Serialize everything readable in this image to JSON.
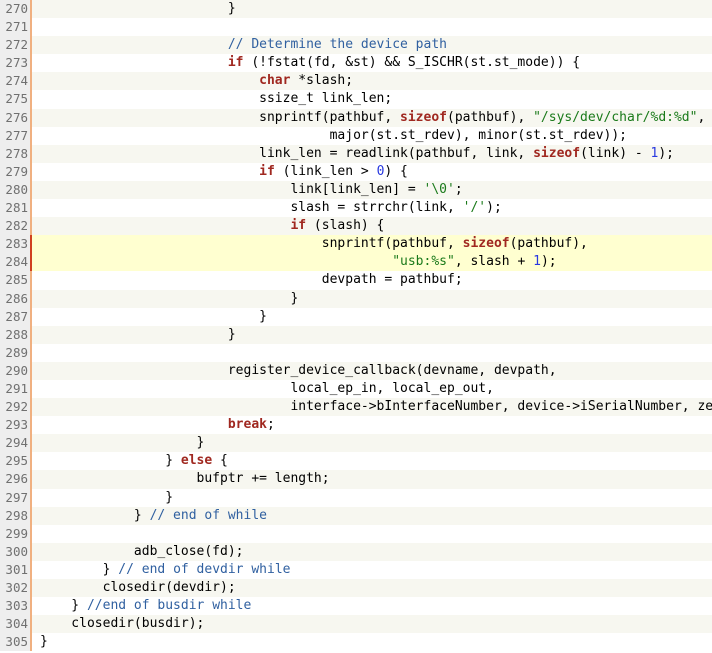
{
  "lines": [
    {
      "n": 270,
      "alt": true,
      "hl": false,
      "g": false,
      "segs": [
        {
          "t": "                        }",
          "c": ""
        }
      ]
    },
    {
      "n": 271,
      "alt": false,
      "hl": false,
      "g": false,
      "segs": [
        {
          "t": "",
          "c": ""
        }
      ]
    },
    {
      "n": 272,
      "alt": true,
      "hl": false,
      "g": false,
      "segs": [
        {
          "t": "                        ",
          "c": ""
        },
        {
          "t": "// Determine the device path",
          "c": "cm"
        }
      ]
    },
    {
      "n": 273,
      "alt": false,
      "hl": false,
      "g": false,
      "segs": [
        {
          "t": "                        ",
          "c": ""
        },
        {
          "t": "if",
          "c": "kw"
        },
        {
          "t": " (!fstat(fd, &st) && S_ISCHR(st.st_mode)) {",
          "c": ""
        }
      ]
    },
    {
      "n": 274,
      "alt": true,
      "hl": false,
      "g": false,
      "segs": [
        {
          "t": "                            ",
          "c": ""
        },
        {
          "t": "char",
          "c": "kw"
        },
        {
          "t": " *slash;",
          "c": ""
        }
      ]
    },
    {
      "n": 275,
      "alt": false,
      "hl": false,
      "g": false,
      "segs": [
        {
          "t": "                            ssize_t link_len;",
          "c": ""
        }
      ]
    },
    {
      "n": 276,
      "alt": true,
      "hl": false,
      "g": false,
      "segs": [
        {
          "t": "                            snprintf(pathbuf, ",
          "c": ""
        },
        {
          "t": "sizeof",
          "c": "kw"
        },
        {
          "t": "(pathbuf), ",
          "c": ""
        },
        {
          "t": "\"/sys/dev/char/%d:%d\"",
          "c": "st"
        },
        {
          "t": ",",
          "c": ""
        }
      ]
    },
    {
      "n": 277,
      "alt": false,
      "hl": false,
      "g": false,
      "segs": [
        {
          "t": "                                     major(st.st_rdev), minor(st.st_rdev));",
          "c": ""
        }
      ]
    },
    {
      "n": 278,
      "alt": true,
      "hl": false,
      "g": false,
      "segs": [
        {
          "t": "                            link_len = readlink(pathbuf, link, ",
          "c": ""
        },
        {
          "t": "sizeof",
          "c": "kw"
        },
        {
          "t": "(link) - ",
          "c": ""
        },
        {
          "t": "1",
          "c": "lit"
        },
        {
          "t": ");",
          "c": ""
        }
      ]
    },
    {
      "n": 279,
      "alt": false,
      "hl": false,
      "g": false,
      "segs": [
        {
          "t": "                            ",
          "c": ""
        },
        {
          "t": "if",
          "c": "kw"
        },
        {
          "t": " (link_len > ",
          "c": ""
        },
        {
          "t": "0",
          "c": "lit"
        },
        {
          "t": ") {",
          "c": ""
        }
      ]
    },
    {
      "n": 280,
      "alt": true,
      "hl": false,
      "g": false,
      "segs": [
        {
          "t": "                                link[link_len] = ",
          "c": ""
        },
        {
          "t": "'\\0'",
          "c": "st"
        },
        {
          "t": ";",
          "c": ""
        }
      ]
    },
    {
      "n": 281,
      "alt": false,
      "hl": false,
      "g": false,
      "segs": [
        {
          "t": "                                slash = strrchr(link, ",
          "c": ""
        },
        {
          "t": "'/'",
          "c": "st"
        },
        {
          "t": ");",
          "c": ""
        }
      ]
    },
    {
      "n": 282,
      "alt": true,
      "hl": false,
      "g": false,
      "segs": [
        {
          "t": "                                ",
          "c": ""
        },
        {
          "t": "if",
          "c": "kw"
        },
        {
          "t": " (slash) {",
          "c": ""
        }
      ]
    },
    {
      "n": 283,
      "alt": false,
      "hl": true,
      "g": true,
      "segs": [
        {
          "t": "                                    snprintf(pathbuf, ",
          "c": ""
        },
        {
          "t": "sizeof",
          "c": "kw"
        },
        {
          "t": "(pathbuf),",
          "c": ""
        }
      ]
    },
    {
      "n": 284,
      "alt": true,
      "hl": true,
      "g": true,
      "segs": [
        {
          "t": "                                             ",
          "c": ""
        },
        {
          "t": "\"usb:%s\"",
          "c": "st"
        },
        {
          "t": ", slash + ",
          "c": ""
        },
        {
          "t": "1",
          "c": "lit"
        },
        {
          "t": ");",
          "c": ""
        }
      ]
    },
    {
      "n": 285,
      "alt": false,
      "hl": false,
      "g": false,
      "segs": [
        {
          "t": "                                    devpath = pathbuf;",
          "c": ""
        }
      ]
    },
    {
      "n": 286,
      "alt": true,
      "hl": false,
      "g": false,
      "segs": [
        {
          "t": "                                }",
          "c": ""
        }
      ]
    },
    {
      "n": 287,
      "alt": false,
      "hl": false,
      "g": false,
      "segs": [
        {
          "t": "                            }",
          "c": ""
        }
      ]
    },
    {
      "n": 288,
      "alt": true,
      "hl": false,
      "g": false,
      "segs": [
        {
          "t": "                        }",
          "c": ""
        }
      ]
    },
    {
      "n": 289,
      "alt": false,
      "hl": false,
      "g": false,
      "segs": [
        {
          "t": "",
          "c": ""
        }
      ]
    },
    {
      "n": 290,
      "alt": true,
      "hl": false,
      "g": false,
      "segs": [
        {
          "t": "                        register_device_callback(devname, devpath,",
          "c": ""
        }
      ]
    },
    {
      "n": 291,
      "alt": false,
      "hl": false,
      "g": false,
      "segs": [
        {
          "t": "                                local_ep_in, local_ep_out,",
          "c": ""
        }
      ]
    },
    {
      "n": 292,
      "alt": true,
      "hl": false,
      "g": false,
      "segs": [
        {
          "t": "                                interface->bInterfaceNumber, device->iSerialNumber, zero_mask);",
          "c": ""
        }
      ]
    },
    {
      "n": 293,
      "alt": false,
      "hl": false,
      "g": false,
      "segs": [
        {
          "t": "                        ",
          "c": ""
        },
        {
          "t": "break",
          "c": "kw"
        },
        {
          "t": ";",
          "c": ""
        }
      ]
    },
    {
      "n": 294,
      "alt": true,
      "hl": false,
      "g": false,
      "segs": [
        {
          "t": "                    }",
          "c": ""
        }
      ]
    },
    {
      "n": 295,
      "alt": false,
      "hl": false,
      "g": false,
      "segs": [
        {
          "t": "                } ",
          "c": ""
        },
        {
          "t": "else",
          "c": "kw"
        },
        {
          "t": " {",
          "c": ""
        }
      ]
    },
    {
      "n": 296,
      "alt": true,
      "hl": false,
      "g": false,
      "segs": [
        {
          "t": "                    bufptr += length;",
          "c": ""
        }
      ]
    },
    {
      "n": 297,
      "alt": false,
      "hl": false,
      "g": false,
      "segs": [
        {
          "t": "                }",
          "c": ""
        }
      ]
    },
    {
      "n": 298,
      "alt": true,
      "hl": false,
      "g": false,
      "segs": [
        {
          "t": "            } ",
          "c": ""
        },
        {
          "t": "// end of while",
          "c": "cm"
        }
      ]
    },
    {
      "n": 299,
      "alt": false,
      "hl": false,
      "g": false,
      "segs": [
        {
          "t": "",
          "c": ""
        }
      ]
    },
    {
      "n": 300,
      "alt": true,
      "hl": false,
      "g": false,
      "segs": [
        {
          "t": "            adb_close(fd);",
          "c": ""
        }
      ]
    },
    {
      "n": 301,
      "alt": false,
      "hl": false,
      "g": false,
      "segs": [
        {
          "t": "        } ",
          "c": ""
        },
        {
          "t": "// end of devdir while",
          "c": "cm"
        }
      ]
    },
    {
      "n": 302,
      "alt": true,
      "hl": false,
      "g": false,
      "segs": [
        {
          "t": "        closedir(devdir);",
          "c": ""
        }
      ]
    },
    {
      "n": 303,
      "alt": false,
      "hl": false,
      "g": false,
      "segs": [
        {
          "t": "    } ",
          "c": ""
        },
        {
          "t": "//end of busdir while",
          "c": "cm"
        }
      ]
    },
    {
      "n": 304,
      "alt": true,
      "hl": false,
      "g": false,
      "segs": [
        {
          "t": "    closedir(busdir);",
          "c": ""
        }
      ]
    },
    {
      "n": 305,
      "alt": false,
      "hl": false,
      "g": false,
      "segs": [
        {
          "t": "}",
          "c": ""
        }
      ]
    }
  ]
}
